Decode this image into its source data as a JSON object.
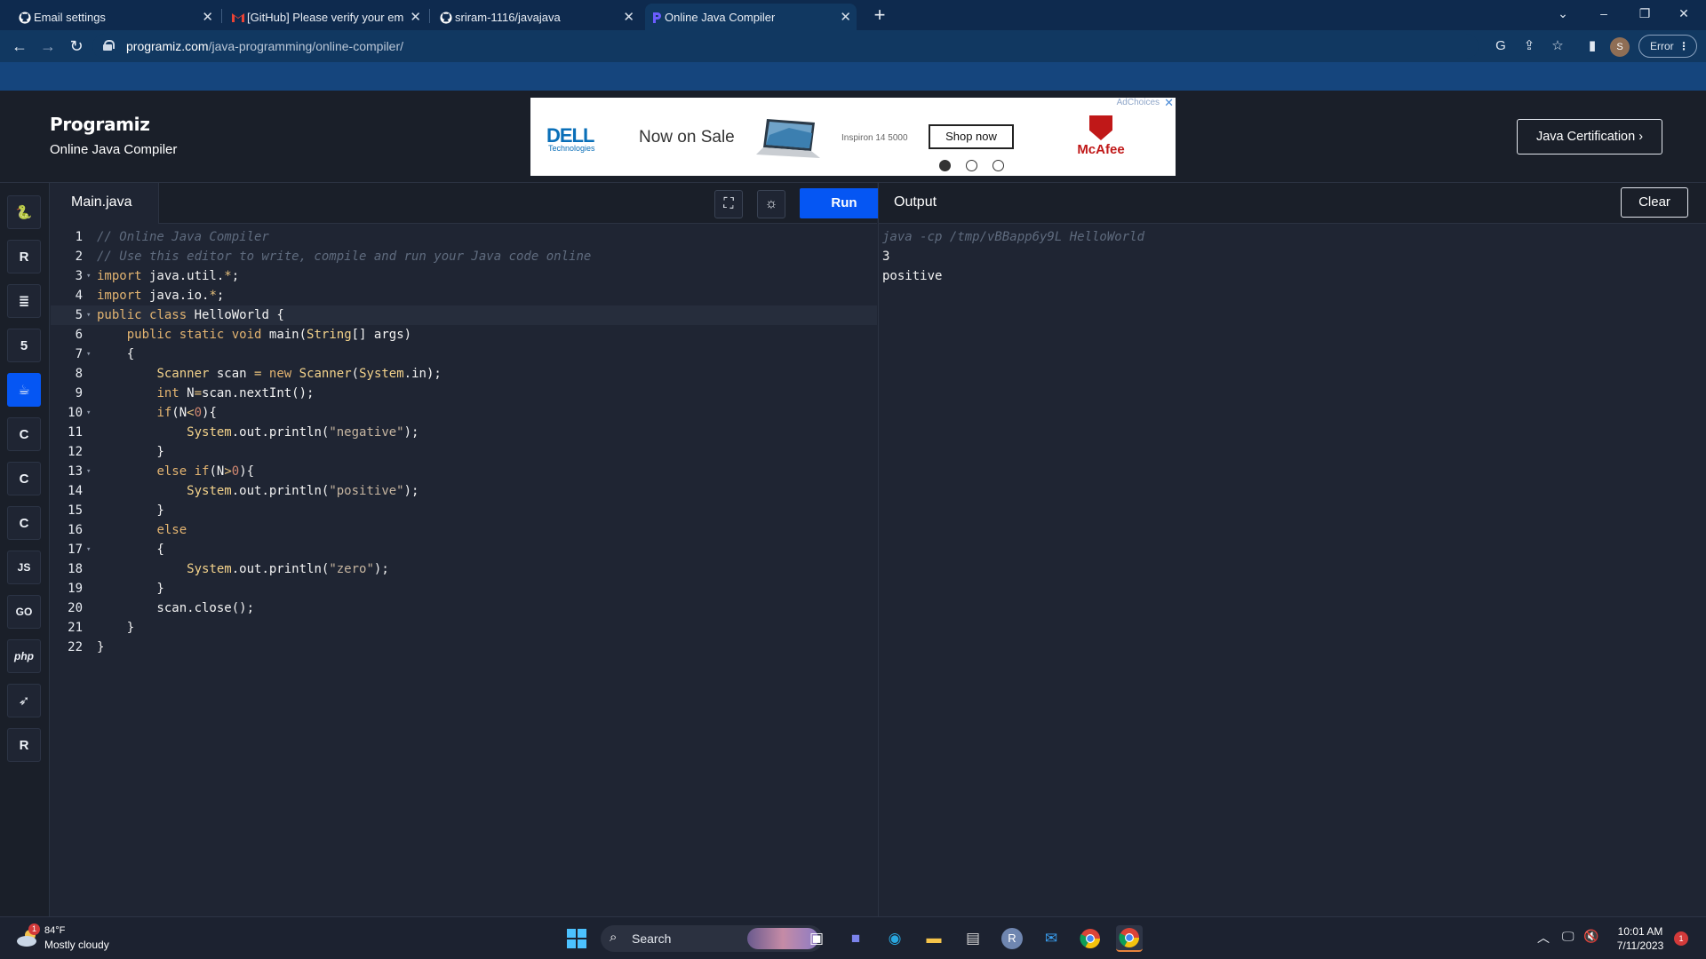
{
  "browser": {
    "tabs": [
      {
        "title": "Email settings",
        "icon": "github-icon"
      },
      {
        "title": "[GitHub] Please verify your email",
        "icon": "gmail-icon"
      },
      {
        "title": "sriram-1116/javajava",
        "icon": "github-icon"
      },
      {
        "title": "Online Java Compiler",
        "icon": "programiz-icon"
      }
    ],
    "url_domain": "programiz.com",
    "url_path": "/java-programming/online-compiler/",
    "profile_initial": "S",
    "error_label": "Error"
  },
  "site": {
    "brand": "Programiz",
    "subtitle": "Online Java Compiler",
    "certification_button": "Java Certification ›"
  },
  "ad": {
    "adchoices": "AdChoices",
    "brand": "DELL",
    "brand_sub": "Technologies",
    "headline": "Now on Sale",
    "model": "Inspiron 14 5000",
    "cta": "Shop now",
    "sponsor": "McAfee"
  },
  "rail": {
    "items": [
      {
        "name": "python",
        "glyph": "🐍"
      },
      {
        "name": "r",
        "glyph": "R"
      },
      {
        "name": "sql",
        "glyph": "≣"
      },
      {
        "name": "html",
        "glyph": "5"
      },
      {
        "name": "java",
        "glyph": "☕"
      },
      {
        "name": "c",
        "glyph": "C"
      },
      {
        "name": "cpp",
        "glyph": "C"
      },
      {
        "name": "csharp",
        "glyph": "C"
      },
      {
        "name": "js",
        "glyph": "JS"
      },
      {
        "name": "go",
        "glyph": "GO"
      },
      {
        "name": "php",
        "glyph": "php"
      },
      {
        "name": "swift",
        "glyph": "➶"
      },
      {
        "name": "rust",
        "glyph": "R"
      }
    ],
    "active": "java"
  },
  "editor": {
    "filename": "Main.java",
    "run_label": "Run",
    "current_line": 5,
    "lines": [
      "// Online Java Compiler",
      "// Use this editor to write, compile and run your Java code online",
      "import java.util.*;",
      "import java.io.*;",
      "public class HelloWorld {",
      "    public static void main(String[] args)",
      "    {",
      "        Scanner scan = new Scanner(System.in);",
      "        int N=scan.nextInt();",
      "        if(N<0){",
      "            System.out.println(\"negative\");",
      "        }",
      "        else if(N>0){",
      "            System.out.println(\"positive\");",
      "        }",
      "        else",
      "        {",
      "            System.out.println(\"zero\");",
      "        }",
      "        scan.close();",
      "    }",
      "}"
    ],
    "foldable_lines": [
      3,
      5,
      7,
      10,
      13,
      17
    ]
  },
  "output": {
    "title": "Output",
    "clear_label": "Clear",
    "lines": [
      {
        "text": "java -cp /tmp/vBBapp6y9L HelloWorld",
        "kind": "command"
      },
      {
        "text": "3",
        "kind": "stdout"
      },
      {
        "text": "positive",
        "kind": "stdout"
      }
    ]
  },
  "taskbar": {
    "temperature": "84°F",
    "condition": "Mostly cloudy",
    "weather_badge": "1",
    "search_label": "Search",
    "time": "10:01 AM",
    "date": "7/11/2023",
    "notification_count": "1"
  }
}
